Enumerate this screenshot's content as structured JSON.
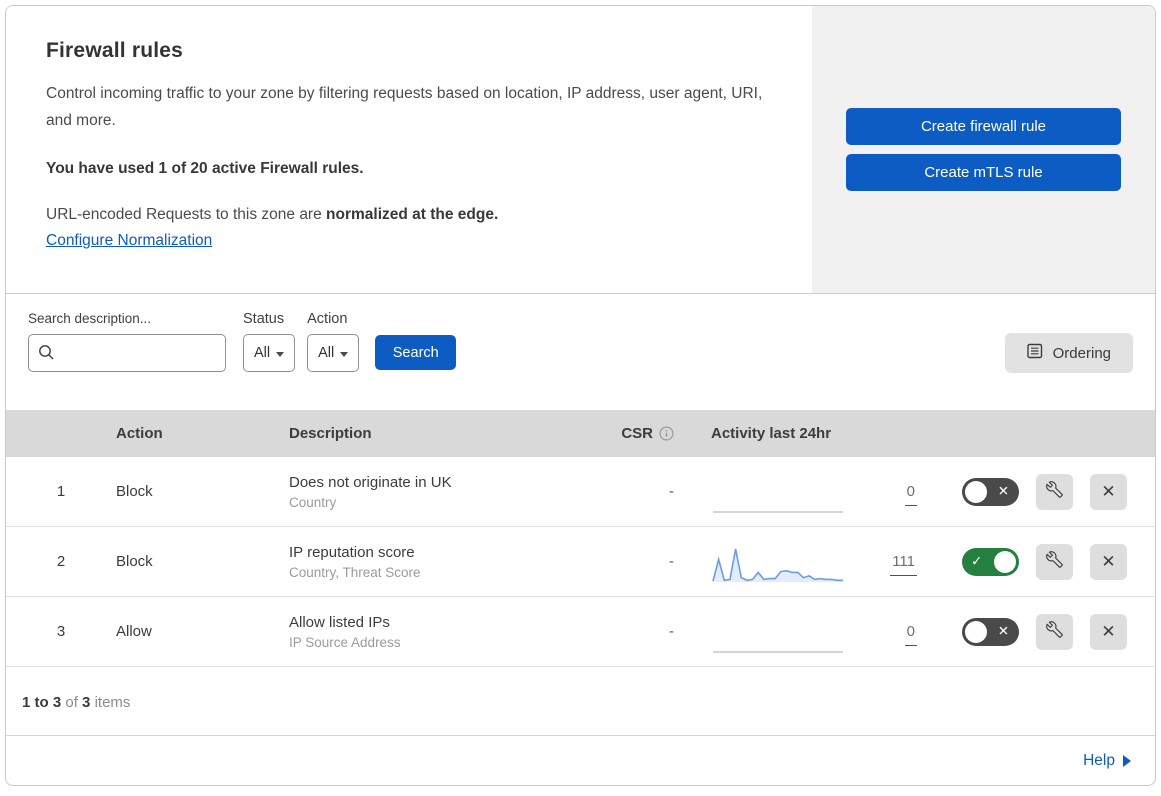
{
  "colors": {
    "accent_blue": "#0d5cc4",
    "toggle_on_green": "#23803f",
    "toggle_off_gray": "#4a4a4a",
    "sparkline_blue": "#6d9ce6",
    "sparkline_fill": "#e3ecf9",
    "flat_line_gray": "#c9c9c9"
  },
  "header_card": {
    "title": "Firewall rules",
    "description": "Control incoming traffic to your zone by filtering requests based on location, IP address, user agent, URI, and more.",
    "usage": "You have used 1 of 20 active Firewall rules.",
    "normalization_prefix": "URL-encoded Requests to this zone are ",
    "normalization_bold": "normalized at the edge.",
    "configure_link": "Configure Normalization",
    "create_firewall_button": "Create firewall rule",
    "create_mtls_button": "Create mTLS rule"
  },
  "filters": {
    "search_label": "Search description...",
    "status_label": "Status",
    "status_value": "All",
    "action_label": "Action",
    "action_value": "All",
    "search_button": "Search",
    "ordering_button": "Ordering"
  },
  "table": {
    "columns": {
      "action": "Action",
      "description": "Description",
      "csr": "CSR",
      "activity": "Activity last 24hr"
    },
    "rows": [
      {
        "priority": "1",
        "action": "Block",
        "description": "Does not originate in UK",
        "fields": "Country",
        "csr": "-",
        "activity_count": "0",
        "enabled": false,
        "sparkline": []
      },
      {
        "priority": "2",
        "action": "Block",
        "description": "IP reputation score",
        "fields": "Country, Threat Score",
        "csr": "-",
        "activity_count": "111",
        "enabled": true,
        "sparkline": [
          1,
          26,
          2,
          3,
          38,
          5,
          2,
          3,
          11,
          3,
          4,
          4,
          12,
          13,
          11,
          11,
          5,
          7,
          3,
          4,
          3,
          3,
          2,
          2
        ]
      },
      {
        "priority": "3",
        "action": "Allow",
        "description": "Allow listed IPs",
        "fields": "IP Source Address",
        "csr": "-",
        "activity_count": "0",
        "enabled": false,
        "sparkline": []
      }
    ]
  },
  "footer": {
    "range": "1 to 3",
    "of_label": "of",
    "total": "3",
    "items_label": "items"
  },
  "help": {
    "label": "Help"
  },
  "icons": {
    "check": "✓",
    "cross": "✕"
  }
}
